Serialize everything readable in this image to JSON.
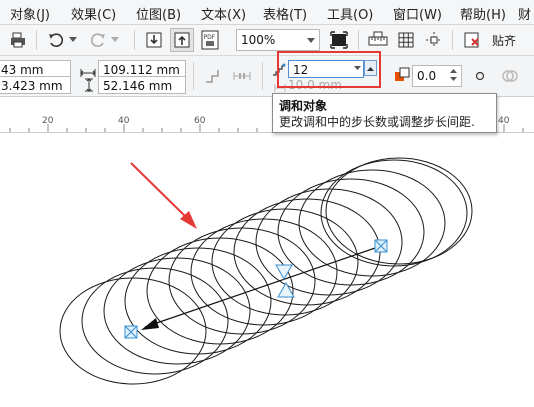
{
  "menu": [
    {
      "label": "对象(J)"
    },
    {
      "label": "效果(C)"
    },
    {
      "label": "位图(B)"
    },
    {
      "label": "文本(X)"
    },
    {
      "label": "表格(T)"
    },
    {
      "label": "工具(O)"
    },
    {
      "label": "窗口(W)"
    },
    {
      "label": "帮助(H)"
    },
    {
      "label": "财"
    }
  ],
  "toolbar": {
    "zoom_value": "100%",
    "snap_label": "贴齐",
    "pdf_label": "PDF"
  },
  "properties": {
    "x_value": "43 mm",
    "y_value": "3.423 mm",
    "width_value": "109.112 mm",
    "height_value": "52.146 mm",
    "steps_value": "12",
    "spacing_value": "10.0 mm",
    "rotation_value": "0.0"
  },
  "ruler": {
    "labels": [
      "20",
      "40",
      "60",
      "40"
    ]
  },
  "tooltip": {
    "title": "调和对象",
    "description": "更改调和中的步长数或调整步长间距."
  },
  "colors": {
    "highlight": "#e53935",
    "arrow": "#e53935",
    "handle": "#3a8fd1"
  },
  "icons": [
    "printer-icon",
    "undo-icon",
    "redo-icon",
    "import-icon",
    "export-icon",
    "pdf-icon",
    "fullscreen-icon",
    "rulers-icon",
    "grid-icon",
    "guidelines-icon",
    "snap-icon"
  ]
}
